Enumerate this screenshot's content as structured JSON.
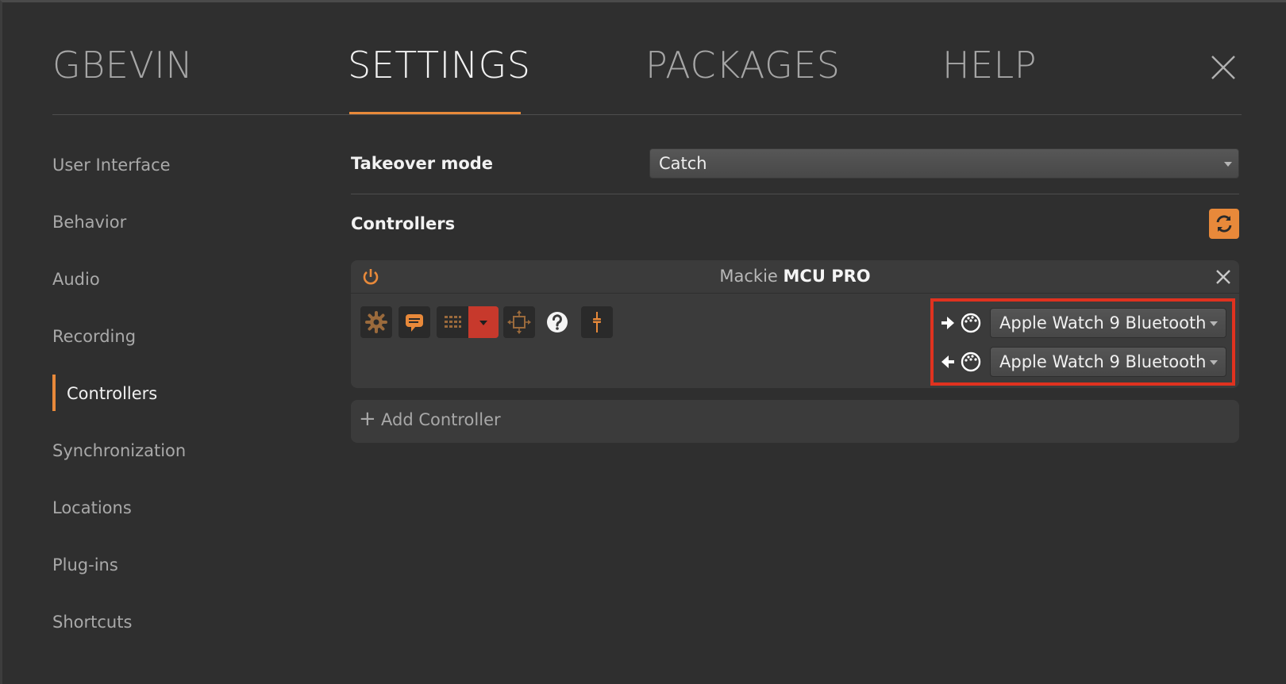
{
  "nav": {
    "tabs": [
      {
        "label": "GBEVIN",
        "active": false
      },
      {
        "label": "SETTINGS",
        "active": true
      },
      {
        "label": "PACKAGES",
        "active": false
      },
      {
        "label": "HELP",
        "active": false
      }
    ],
    "close_icon": "close-icon"
  },
  "sidebar": {
    "items": [
      {
        "label": "User Interface"
      },
      {
        "label": "Behavior"
      },
      {
        "label": "Audio"
      },
      {
        "label": "Recording"
      },
      {
        "label": "Controllers",
        "active": true
      },
      {
        "label": "Synchronization"
      },
      {
        "label": "Locations"
      },
      {
        "label": "Plug-ins"
      },
      {
        "label": "Shortcuts"
      }
    ]
  },
  "main": {
    "takeover": {
      "label": "Takeover mode",
      "value": "Catch"
    },
    "controllers_label": "Controllers",
    "refresh_icon": "refresh-icon",
    "controller": {
      "maker": "Mackie",
      "model": "MCU PRO",
      "toolbar_icons": [
        "gear-icon",
        "chat-icon",
        "grid-icon",
        "dropdown-icon",
        "move-icon",
        "help-icon",
        "fader-icon"
      ],
      "input_port": "Apple Watch 9 Bluetooth",
      "output_port": "Apple Watch 9 Bluetooth"
    },
    "add_controller_label": "Add Controller"
  },
  "colors": {
    "accent": "#e8893a",
    "highlight_box": "#e0321f",
    "background": "#2f2f2f"
  }
}
